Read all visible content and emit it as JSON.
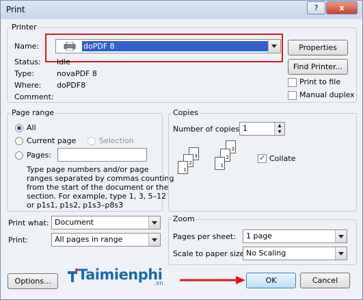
{
  "window": {
    "title": "Print",
    "help_label": "?",
    "close_label": "x"
  },
  "printer": {
    "group_label": "Printer",
    "name_label": "Name:",
    "name_value": "doPDF 8",
    "properties_label": "Properties",
    "find_printer_label": "Find Printer...",
    "status_label": "Status:",
    "status_value": "Idle",
    "type_label": "Type:",
    "type_value": "novaPDF 8",
    "where_label": "Where:",
    "where_value": "doPDF8",
    "comment_label": "Comment:",
    "print_to_file_label": "Print to file",
    "manual_duplex_label": "Manual duplex"
  },
  "page_range": {
    "group_label": "Page range",
    "all_label": "All",
    "current_page_label": "Current page",
    "selection_label": "Selection",
    "pages_label": "Pages:",
    "pages_value": "",
    "help_line1": "Type page numbers and/or page",
    "help_line2": "ranges separated by commas counting",
    "help_line3": "from the start of the document or the",
    "help_line4": "section. For example, type 1, 3, 5–12",
    "help_line5": "or p1s1, p1s2, p1s3–p8s3"
  },
  "copies": {
    "group_label": "Copies",
    "number_label": "Number of copies:",
    "number_value": "1",
    "collate_label": "Collate",
    "page_nums": [
      "3",
      "2",
      "1",
      "3",
      "2",
      "1"
    ]
  },
  "print_what": {
    "label": "Print what:",
    "value": "Document"
  },
  "print": {
    "label": "Print:",
    "value": "All pages in range"
  },
  "zoom": {
    "group_label": "Zoom",
    "pages_per_sheet_label": "Pages per sheet:",
    "pages_per_sheet_value": "1 page",
    "scale_label": "Scale to paper size:",
    "scale_value": "No Scaling"
  },
  "footer": {
    "options_label": "Options...",
    "ok_label": "OK",
    "cancel_label": "Cancel"
  },
  "watermark": {
    "brand": "Taimienphi",
    "domain": ".vn"
  },
  "colors": {
    "highlight": "#3060c8",
    "callout": "#e0141c",
    "accent": "#1b6aa8"
  }
}
